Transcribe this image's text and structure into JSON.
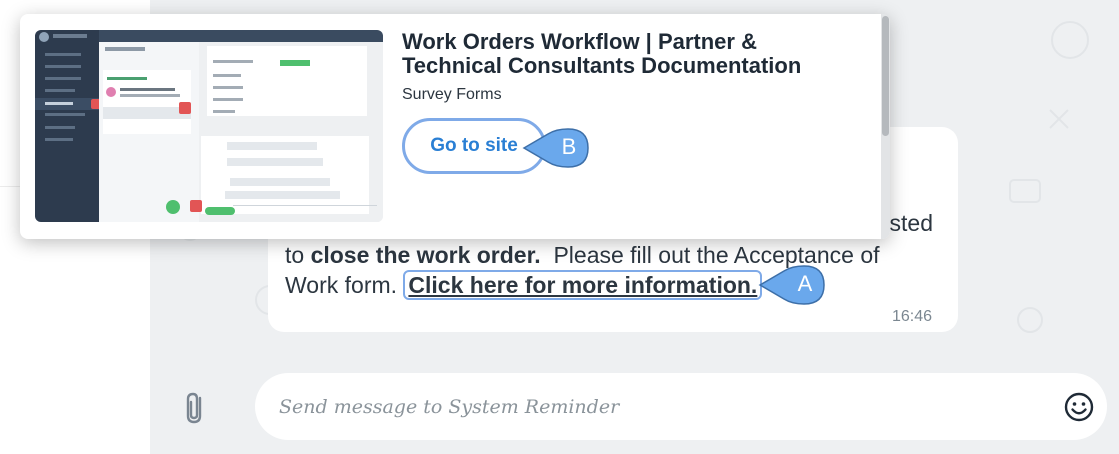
{
  "popup": {
    "title": "Work Orders Workflow | Partner & Technical Consultants Documentation",
    "subtitle": "Survey Forms",
    "goto_label": "Go to site"
  },
  "message": {
    "partial_line": "sted",
    "line2_prefix": "to ",
    "line2_bold": "close the work order.",
    "line2_rest": "  Please fill out the Acceptance of",
    "line3_prefix": "Work form. ",
    "link_text": "Click here for more information.",
    "time": "16:46"
  },
  "callouts": {
    "a": "A",
    "b": "B"
  },
  "composer": {
    "placeholder": "Send message to System Reminder"
  },
  "icons": {
    "attach": "paperclip-icon",
    "emoji": "smiley-icon"
  },
  "colors": {
    "accent": "#2a7fd4",
    "callout": "#6aa8ec",
    "outline": "#7faae8"
  }
}
